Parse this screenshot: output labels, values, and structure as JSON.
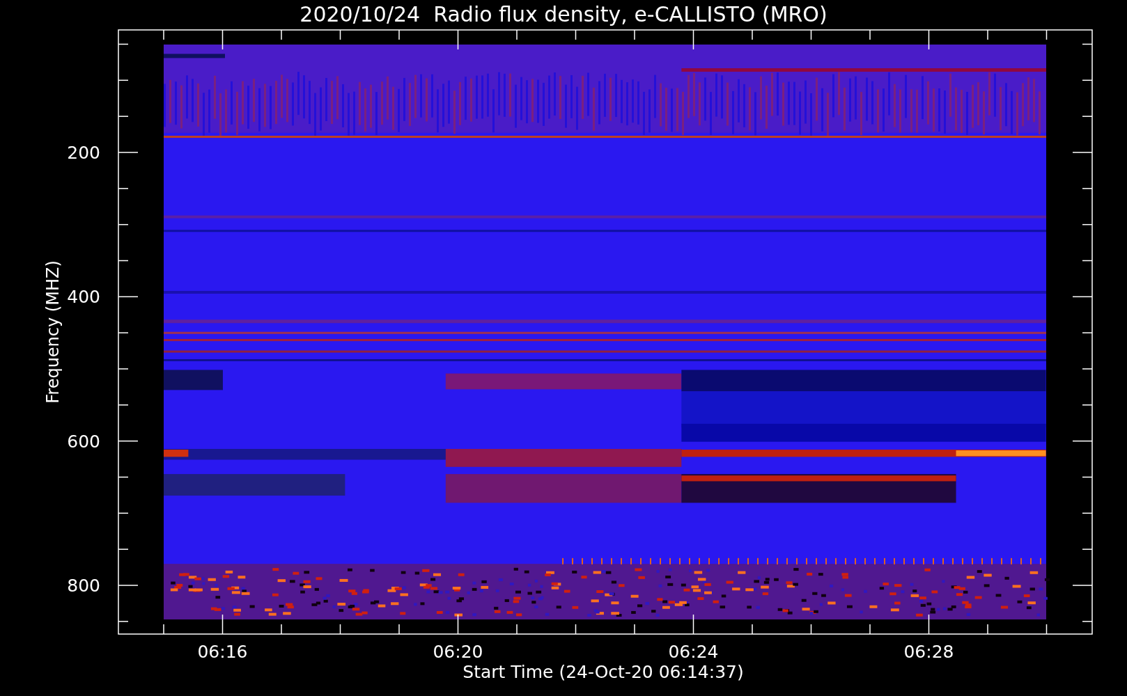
{
  "plot": {
    "title": "2020/10/24  Radio flux density, e-CALLISTO (MRO)",
    "ylabel": "Frequency (MHZ)",
    "xlabel": "Start Time (24-Oct-20 06:14:37)",
    "yticks": [
      "200",
      "400",
      "600",
      "800"
    ],
    "xticks": [
      "06:16",
      "06:20",
      "06:24",
      "06:28"
    ]
  }
}
